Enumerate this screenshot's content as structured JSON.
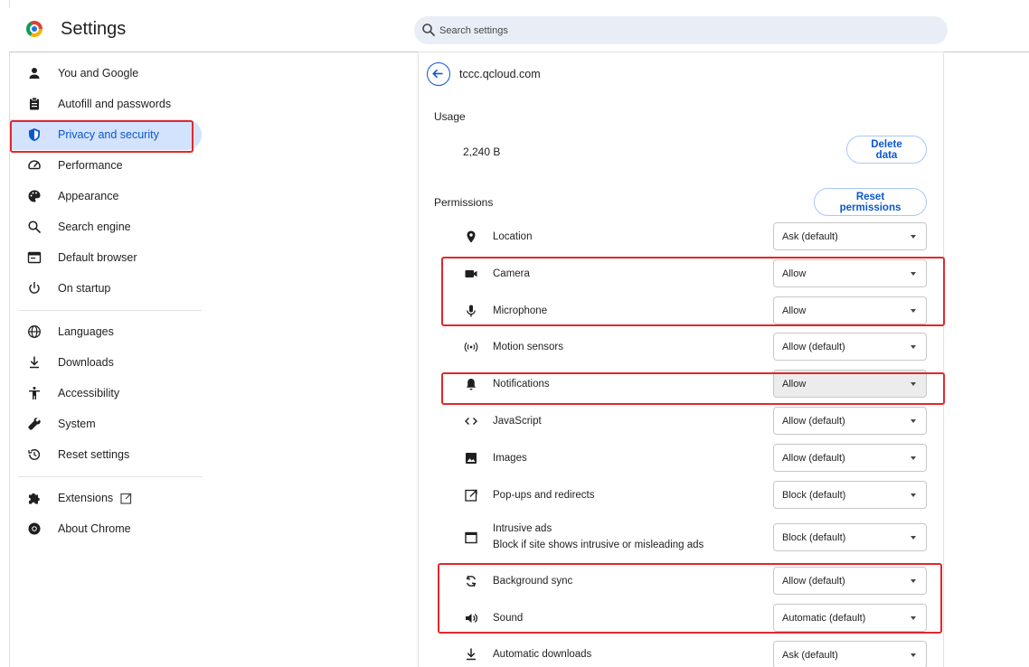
{
  "header": {
    "app_title": "Settings",
    "search_placeholder": "Search settings"
  },
  "sidebar": {
    "items": [
      {
        "label": "You and Google",
        "icon": "person-icon",
        "active": false
      },
      {
        "label": "Autofill and passwords",
        "icon": "clipboard-icon",
        "active": false
      },
      {
        "label": "Privacy and security",
        "icon": "shield-icon",
        "active": true
      },
      {
        "label": "Performance",
        "icon": "speedometer-icon",
        "active": false
      },
      {
        "label": "Appearance",
        "icon": "palette-icon",
        "active": false
      },
      {
        "label": "Search engine",
        "icon": "search-icon",
        "active": false
      },
      {
        "label": "Default browser",
        "icon": "browser-window-icon",
        "active": false
      },
      {
        "label": "On startup",
        "icon": "power-icon",
        "active": false
      },
      {
        "label": "Languages",
        "icon": "globe-icon",
        "active": false
      },
      {
        "label": "Downloads",
        "icon": "download-icon",
        "active": false
      },
      {
        "label": "Accessibility",
        "icon": "accessibility-icon",
        "active": false
      },
      {
        "label": "System",
        "icon": "wrench-icon",
        "active": false
      },
      {
        "label": "Reset settings",
        "icon": "history-icon",
        "active": false
      },
      {
        "label": "Extensions",
        "icon": "puzzle-icon",
        "active": false
      },
      {
        "label": "About Chrome",
        "icon": "chrome-icon",
        "active": false
      }
    ]
  },
  "site": {
    "host": "tccc.qcloud.com",
    "usage_heading": "Usage",
    "usage_value": "2,240 B",
    "delete_data_label": "Delete data",
    "permissions_heading": "Permissions",
    "reset_permissions_label": "Reset permissions"
  },
  "permissions": [
    {
      "label": "Location",
      "value": "Ask (default)",
      "icon": "location-pin-icon"
    },
    {
      "label": "Camera",
      "value": "Allow",
      "icon": "camera-icon"
    },
    {
      "label": "Microphone",
      "value": "Allow",
      "icon": "microphone-icon"
    },
    {
      "label": "Motion sensors",
      "value": "Allow (default)",
      "icon": "sensors-icon"
    },
    {
      "label": "Notifications",
      "value": "Allow",
      "icon": "bell-icon"
    },
    {
      "label": "JavaScript",
      "value": "Allow (default)",
      "icon": "code-icon"
    },
    {
      "label": "Images",
      "value": "Allow (default)",
      "icon": "image-icon"
    },
    {
      "label": "Pop-ups and redirects",
      "value": "Block (default)",
      "icon": "popup-icon"
    },
    {
      "label": "Intrusive ads",
      "sublabel": "Block if site shows intrusive or misleading ads",
      "value": "Block (default)",
      "icon": "ads-window-icon"
    },
    {
      "label": "Background sync",
      "value": "Allow (default)",
      "icon": "sync-icon"
    },
    {
      "label": "Sound",
      "value": "Automatic (default)",
      "icon": "speaker-icon"
    },
    {
      "label": "Automatic downloads",
      "value": "Ask (default)",
      "icon": "download-icon"
    }
  ],
  "colors": {
    "accent": "#0b57d0",
    "active_nav_bg": "#d3e3fd",
    "highlight_red": "#e0282e"
  }
}
